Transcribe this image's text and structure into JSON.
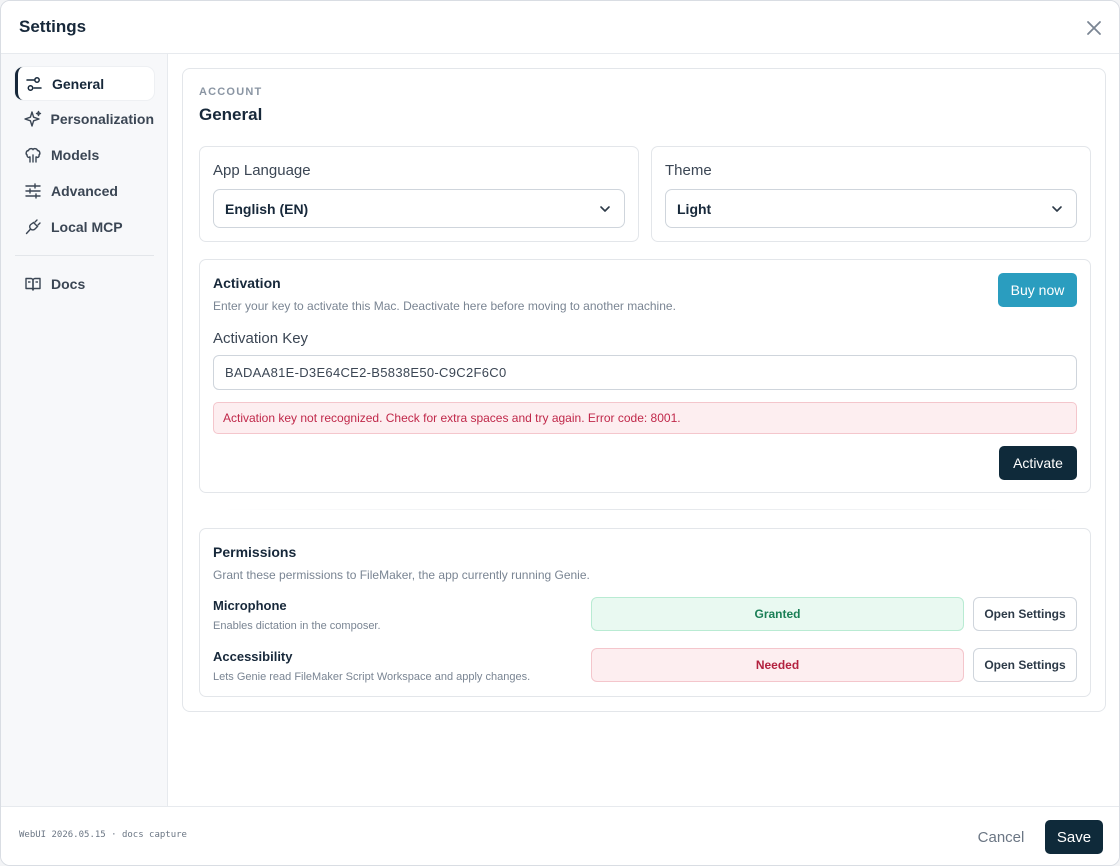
{
  "window": {
    "title": "Settings"
  },
  "sidebar": {
    "items": [
      {
        "label": "General",
        "icon": "sliders-icon",
        "active": true
      },
      {
        "label": "Personalization",
        "icon": "sparkles-icon",
        "active": false
      },
      {
        "label": "Models",
        "icon": "brain-icon",
        "active": false
      },
      {
        "label": "Advanced",
        "icon": "adjustments-icon",
        "active": false
      },
      {
        "label": "Local MCP",
        "icon": "plug-icon",
        "active": false
      },
      {
        "label": "Docs",
        "icon": "book-icon",
        "active": false
      }
    ]
  },
  "main": {
    "eyebrow": "ACCOUNT",
    "title": "General",
    "language": {
      "label": "App Language",
      "value": "English (EN)"
    },
    "theme": {
      "label": "Theme",
      "value": "Light"
    },
    "activation": {
      "title": "Activation",
      "subtitle": "Enter your key to activate this Mac. Deactivate here before moving to another machine.",
      "buy_label": "Buy now",
      "key_label": "Activation Key",
      "key_value": "BADAA81E-D3E64CE2-B5838E50-C9C2F6C0",
      "error": "Activation key not recognized. Check for extra spaces and try again. Error code: 8001.",
      "activate_label": "Activate"
    },
    "permissions": {
      "title": "Permissions",
      "subtitle": "Grant these permissions to FileMaker, the app currently running Genie.",
      "items": [
        {
          "name": "Microphone",
          "desc": "Enables dictation in the composer.",
          "status": "Granted",
          "button": "Open Settings"
        },
        {
          "name": "Accessibility",
          "desc": "Lets Genie read FileMaker Script Workspace and apply changes.",
          "status": "Needed",
          "button": "Open Settings"
        }
      ]
    }
  },
  "footer": {
    "version": "WebUI 2026.05.15 · docs capture",
    "cancel_label": "Cancel",
    "save_label": "Save"
  },
  "colors": {
    "accent": "#2a9dbf",
    "primary_dark": "#0f2a3a",
    "granted": "#1a7f56",
    "needed": "#b3213f"
  }
}
